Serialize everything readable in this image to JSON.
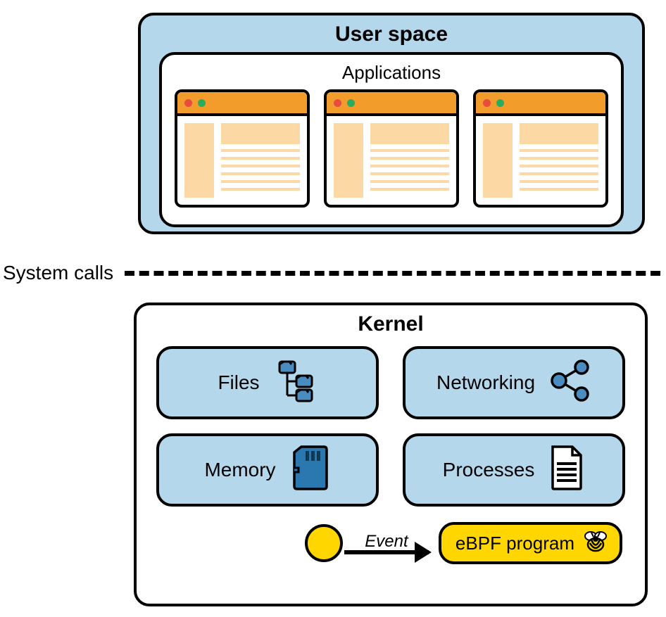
{
  "user_space": {
    "title": "User space",
    "applications_title": "Applications"
  },
  "divider_label": "System calls",
  "kernel": {
    "title": "Kernel",
    "subsystems": {
      "files": "Files",
      "networking": "Networking",
      "memory": "Memory",
      "processes": "Processes"
    },
    "event_label": "Event",
    "ebpf_label": "eBPF program"
  },
  "icons": {
    "files": "folder-tree-icon",
    "networking": "network-share-icon",
    "memory": "memory-card-icon",
    "processes": "document-icon",
    "bee": "bee-icon"
  },
  "colors": {
    "accent_blue": "#b4d7ec",
    "accent_orange": "#f29c2c",
    "accent_light_orange": "#fbd8a4",
    "accent_yellow": "#ffd600",
    "accent_darkblue": "#4a8cbf"
  }
}
